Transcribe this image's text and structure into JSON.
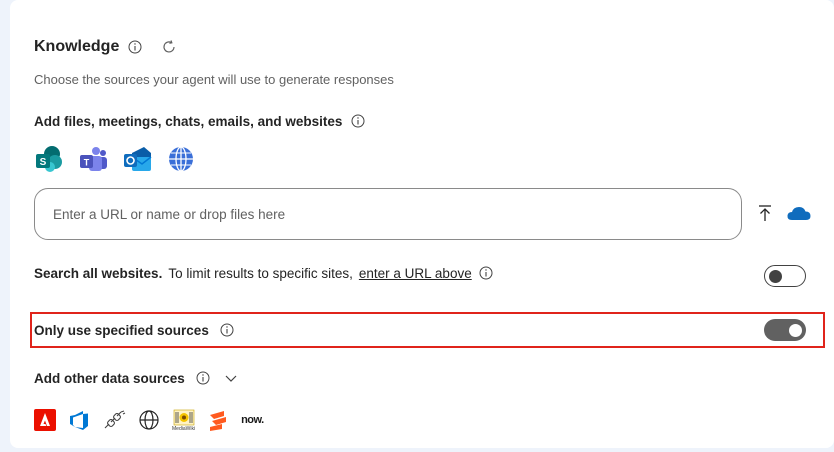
{
  "knowledge": {
    "title": "Knowledge",
    "subtitle": "Choose the sources your agent will use to generate responses"
  },
  "add_section": {
    "heading": "Add files, meetings, chats, emails, and websites",
    "app_icons": [
      "sharepoint-icon",
      "teams-icon",
      "outlook-icon",
      "globe-icon"
    ]
  },
  "url_input": {
    "placeholder": "Enter a URL or name or drop files here",
    "value": ""
  },
  "search_websites": {
    "label_bold": "Search all websites.",
    "label_rest": "To limit results to specific sites,",
    "link": "enter a URL above",
    "toggle_on": false
  },
  "only_specified": {
    "label": "Only use specified sources",
    "toggle_on": true
  },
  "other_sources": {
    "label": "Add other data sources",
    "icons": [
      "adobe-icon",
      "azure-devops-icon",
      "connector-icon",
      "web-icon",
      "mediawiki-icon",
      "salesforce-icon",
      "servicenow-icon"
    ],
    "mediawiki_label": "MediaWiki",
    "servicenow_label": "now."
  },
  "colors": {
    "highlight": "#e0241b",
    "toggle_on": "#616161"
  }
}
